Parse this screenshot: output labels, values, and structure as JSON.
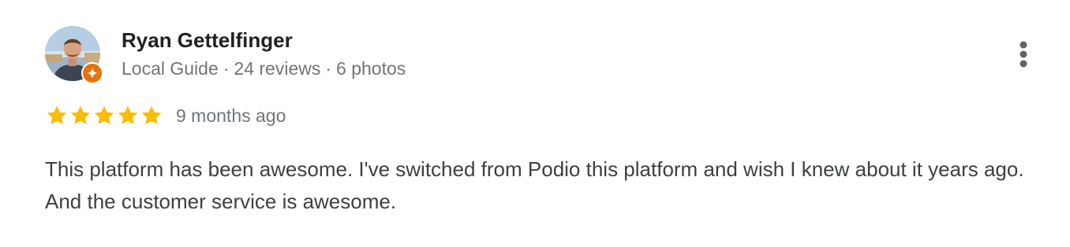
{
  "review": {
    "author": {
      "name": "Ryan Gettelfinger",
      "level": "Local Guide",
      "reviews": "24 reviews",
      "photos": "6 photos",
      "separator": "·",
      "avatar_icon": "profile-photo",
      "badge_icon": "local-guide-star-icon"
    },
    "rating": {
      "stars": 5,
      "max_stars": 5,
      "star_color": "#fbbc04",
      "time_ago": "9 months ago"
    },
    "text": "This platform has been awesome. I've switched from Podio this platform and wish I knew about it years ago. And the customer service is awesome.",
    "menu_icon": "more-vert-icon"
  },
  "colors": {
    "badge": "#e8710a",
    "secondary_text": "#70757a",
    "body_text": "#3c4043"
  }
}
